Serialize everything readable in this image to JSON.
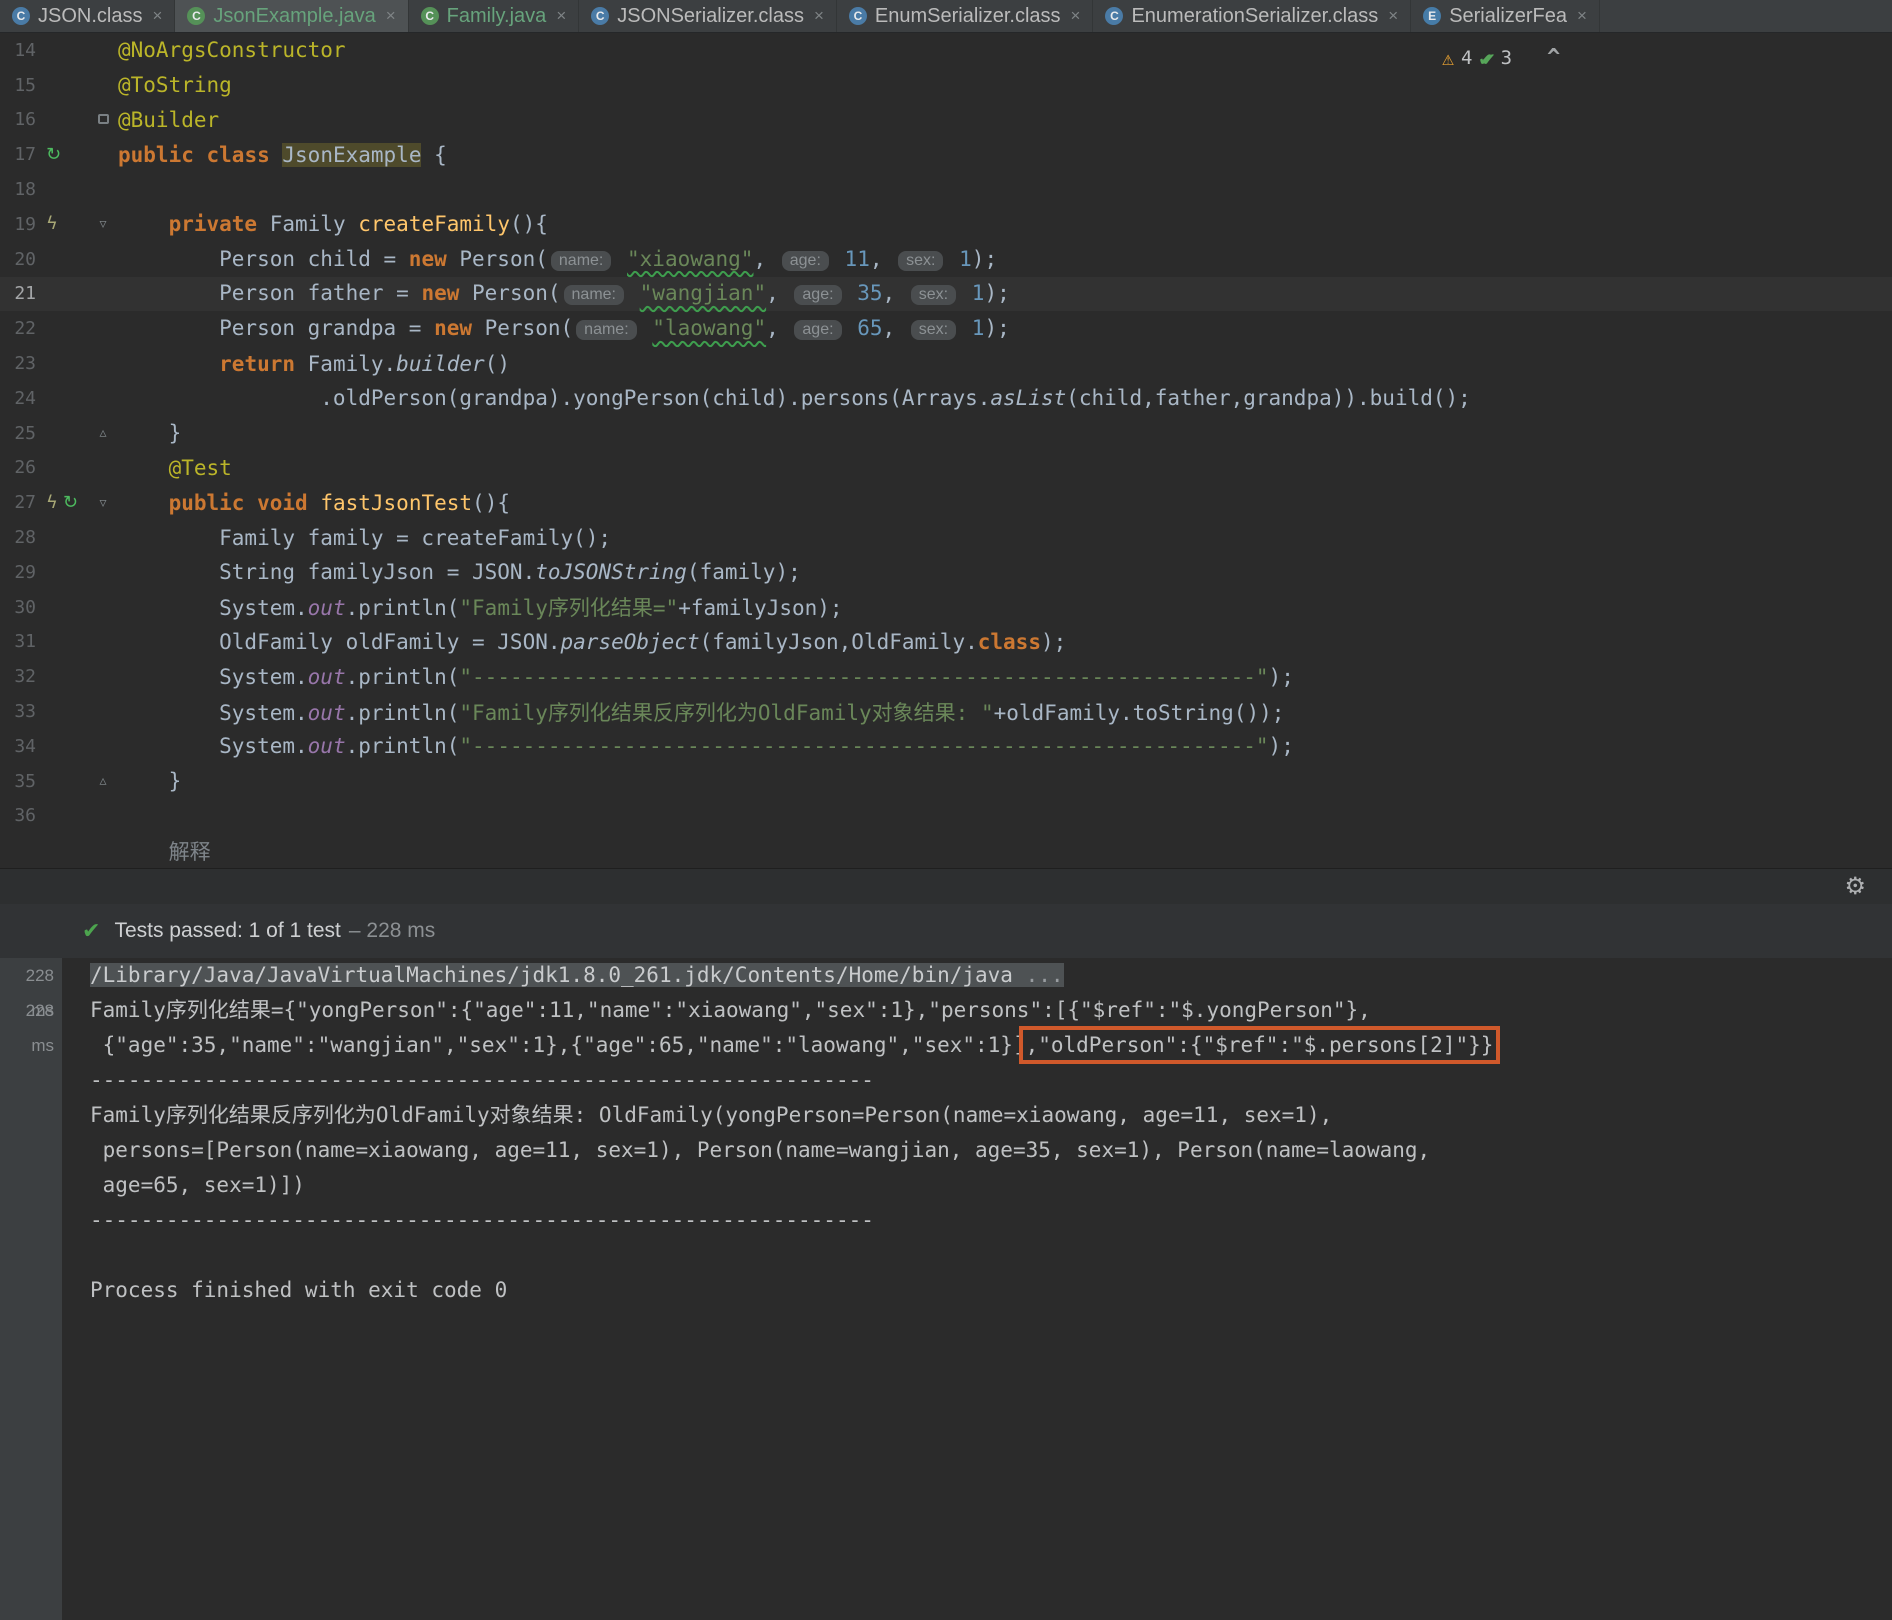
{
  "colors": {
    "accent_green": "#67a37c",
    "annotation_orange": "#d0592b",
    "warning_yellow": "#f0a732",
    "editor_background": "#2b2b2b"
  },
  "tab_bar": {
    "close_glyph": "×",
    "tabs": [
      {
        "label": "JSON.class",
        "icon_letter": "C",
        "icon_class": "fi-blue",
        "icon_name": "class-file-icon",
        "active": false,
        "green": false
      },
      {
        "label": "JsonExample.java",
        "icon_letter": "C",
        "icon_class": "fi-green",
        "icon_name": "test-class-file-icon",
        "active": true,
        "green": true
      },
      {
        "label": "Family.java",
        "icon_letter": "C",
        "icon_class": "fi-green",
        "icon_name": "test-class-file-icon",
        "active": false,
        "green": true
      },
      {
        "label": "JSONSerializer.class",
        "icon_letter": "C",
        "icon_class": "fi-blue",
        "icon_name": "class-file-icon",
        "active": false,
        "green": false
      },
      {
        "label": "EnumSerializer.class",
        "icon_letter": "C",
        "icon_class": "fi-blue",
        "icon_name": "class-file-icon",
        "active": false,
        "green": false
      },
      {
        "label": "EnumerationSerializer.class",
        "icon_letter": "C",
        "icon_class": "fi-blue",
        "icon_name": "class-file-icon",
        "active": false,
        "green": false
      },
      {
        "label": "SerializerFea",
        "icon_letter": "E",
        "icon_class": "fi-enum",
        "icon_name": "enum-file-icon",
        "active": false,
        "green": false
      }
    ]
  },
  "editor": {
    "inspections": {
      "warning_icon": "⚠",
      "warning_count": "4",
      "ok_icon": "✔✔",
      "ok_count": "3",
      "chevron": "^"
    },
    "lines": [
      {
        "num": "14",
        "tokens": [
          {
            "t": "@NoArgsConstructor",
            "s": "ann"
          }
        ]
      },
      {
        "num": "15",
        "tokens": [
          {
            "t": "@ToString",
            "s": "ann"
          }
        ]
      },
      {
        "num": "16",
        "fold": "sq",
        "tokens": [
          {
            "t": "@Builder",
            "s": "ann"
          }
        ]
      },
      {
        "num": "17",
        "gutter": [
          "rerun"
        ],
        "tokens": [
          {
            "t": "public",
            "s": "kw"
          },
          {
            "t": " ",
            "s": "p"
          },
          {
            "t": "class",
            "s": "kw"
          },
          {
            "t": " ",
            "s": "p"
          },
          {
            "t": "JsonExample",
            "s": "hl"
          },
          {
            "t": " {",
            "s": "p"
          }
        ]
      },
      {
        "num": "18",
        "tokens": []
      },
      {
        "num": "19",
        "gutter": [
          "bolt"
        ],
        "fold": "down",
        "tokens": [
          {
            "t": "    ",
            "s": "p"
          },
          {
            "t": "private",
            "s": "kw"
          },
          {
            "t": " Family ",
            "s": "p"
          },
          {
            "t": "createFamily",
            "s": "md"
          },
          {
            "t": "(){",
            "s": "p"
          }
        ]
      },
      {
        "num": "20",
        "tokens": [
          {
            "t": "        Person child = ",
            "s": "p"
          },
          {
            "t": "new",
            "s": "kw"
          },
          {
            "t": " Person(",
            "s": "p"
          },
          {
            "t": "name:",
            "s": "hint"
          },
          {
            "t": " ",
            "s": "p"
          },
          {
            "t": "\"xiaowang\"",
            "s": "sw"
          },
          {
            "t": ", ",
            "s": "p"
          },
          {
            "t": "age:",
            "s": "hint"
          },
          {
            "t": " ",
            "s": "p"
          },
          {
            "t": "11",
            "s": "num"
          },
          {
            "t": ", ",
            "s": "p"
          },
          {
            "t": "sex:",
            "s": "hint"
          },
          {
            "t": " ",
            "s": "p"
          },
          {
            "t": "1",
            "s": "num"
          },
          {
            "t": ");",
            "s": "p"
          }
        ]
      },
      {
        "num": "21",
        "current": true,
        "tokens": [
          {
            "t": "        Person father = ",
            "s": "p"
          },
          {
            "t": "new",
            "s": "kw"
          },
          {
            "t": " Person(",
            "s": "p"
          },
          {
            "t": "name:",
            "s": "hint"
          },
          {
            "t": " ",
            "s": "p"
          },
          {
            "t": "\"wangjian\"",
            "s": "sw"
          },
          {
            "t": ", ",
            "s": "p"
          },
          {
            "t": "age:",
            "s": "hint"
          },
          {
            "t": " ",
            "s": "p"
          },
          {
            "t": "35",
            "s": "num"
          },
          {
            "t": ", ",
            "s": "p"
          },
          {
            "t": "sex:",
            "s": "hint"
          },
          {
            "t": " ",
            "s": "p"
          },
          {
            "t": "1",
            "s": "num"
          },
          {
            "t": ");",
            "s": "p"
          }
        ]
      },
      {
        "num": "22",
        "tokens": [
          {
            "t": "        Person grandpa = ",
            "s": "p"
          },
          {
            "t": "new",
            "s": "kw"
          },
          {
            "t": " Person(",
            "s": "p"
          },
          {
            "t": "name:",
            "s": "hint"
          },
          {
            "t": " ",
            "s": "p"
          },
          {
            "t": "\"laowang\"",
            "s": "sw"
          },
          {
            "t": ", ",
            "s": "p"
          },
          {
            "t": "age:",
            "s": "hint"
          },
          {
            "t": " ",
            "s": "p"
          },
          {
            "t": "65",
            "s": "num"
          },
          {
            "t": ", ",
            "s": "p"
          },
          {
            "t": "sex:",
            "s": "hint"
          },
          {
            "t": " ",
            "s": "p"
          },
          {
            "t": "1",
            "s": "num"
          },
          {
            "t": ");",
            "s": "p"
          }
        ]
      },
      {
        "num": "23",
        "tokens": [
          {
            "t": "        ",
            "s": "p"
          },
          {
            "t": "return",
            "s": "kw"
          },
          {
            "t": " Family.",
            "s": "p"
          },
          {
            "t": "builder",
            "s": "sm"
          },
          {
            "t": "()",
            "s": "p"
          }
        ]
      },
      {
        "num": "24",
        "tokens": [
          {
            "t": "                .oldPerson(grandpa).yongPerson(child).persons(Arrays.",
            "s": "p"
          },
          {
            "t": "asList",
            "s": "sm"
          },
          {
            "t": "(child,father,grandpa)).build();",
            "s": "p"
          }
        ]
      },
      {
        "num": "25",
        "fold": "up",
        "tokens": [
          {
            "t": "    }",
            "s": "p"
          }
        ]
      },
      {
        "num": "26",
        "tokens": [
          {
            "t": "    ",
            "s": "p"
          },
          {
            "t": "@Test",
            "s": "ann"
          }
        ]
      },
      {
        "num": "27",
        "gutter": [
          "bolt",
          "rerun"
        ],
        "fold": "down",
        "tokens": [
          {
            "t": "    ",
            "s": "p"
          },
          {
            "t": "public",
            "s": "kw"
          },
          {
            "t": " ",
            "s": "p"
          },
          {
            "t": "void",
            "s": "kw"
          },
          {
            "t": " ",
            "s": "p"
          },
          {
            "t": "fastJsonTest",
            "s": "md"
          },
          {
            "t": "(){",
            "s": "p"
          }
        ]
      },
      {
        "num": "28",
        "tokens": [
          {
            "t": "        Family family = createFamily();",
            "s": "p"
          }
        ]
      },
      {
        "num": "29",
        "tokens": [
          {
            "t": "        String familyJson = JSON.",
            "s": "p"
          },
          {
            "t": "toJSONString",
            "s": "sm"
          },
          {
            "t": "(family);",
            "s": "p"
          }
        ]
      },
      {
        "num": "30",
        "tokens": [
          {
            "t": "        System.",
            "s": "p"
          },
          {
            "t": "out",
            "s": "fld"
          },
          {
            "t": ".println(",
            "s": "p"
          },
          {
            "t": "\"Family序列化结果=\"",
            "s": "str"
          },
          {
            "t": "+familyJson);",
            "s": "p"
          }
        ]
      },
      {
        "num": "31",
        "tokens": [
          {
            "t": "        OldFamily oldFamily = JSON.",
            "s": "p"
          },
          {
            "t": "parseObject",
            "s": "sm"
          },
          {
            "t": "(familyJson,OldFamily.",
            "s": "p"
          },
          {
            "t": "class",
            "s": "kw"
          },
          {
            "t": ");",
            "s": "p"
          }
        ]
      },
      {
        "num": "32",
        "tokens": [
          {
            "t": "        System.",
            "s": "p"
          },
          {
            "t": "out",
            "s": "fld"
          },
          {
            "t": ".println(",
            "s": "p"
          },
          {
            "t": "\"--------------------------------------------------------------\"",
            "s": "str"
          },
          {
            "t": ");",
            "s": "p"
          }
        ]
      },
      {
        "num": "33",
        "tokens": [
          {
            "t": "        System.",
            "s": "p"
          },
          {
            "t": "out",
            "s": "fld"
          },
          {
            "t": ".println(",
            "s": "p"
          },
          {
            "t": "\"Family序列化结果反序列化为OldFamily对象结果: \"",
            "s": "str"
          },
          {
            "t": "+oldFamily.toString());",
            "s": "p"
          }
        ]
      },
      {
        "num": "34",
        "tokens": [
          {
            "t": "        System.",
            "s": "p"
          },
          {
            "t": "out",
            "s": "fld"
          },
          {
            "t": ".println(",
            "s": "p"
          },
          {
            "t": "\"--------------------------------------------------------------\"",
            "s": "str"
          },
          {
            "t": ");",
            "s": "p"
          }
        ]
      },
      {
        "num": "35",
        "fold": "up",
        "tokens": [
          {
            "t": "    }",
            "s": "p"
          }
        ]
      },
      {
        "num": "36",
        "tokens": []
      },
      {
        "num": "",
        "tokens": [
          {
            "t": "    解释",
            "s": "inlay"
          }
        ]
      }
    ]
  },
  "run_panel": {
    "status": {
      "icon": "✔",
      "text": "Tests passed: 1 of 1 test",
      "duration": "– 228 ms"
    },
    "gear_icon": "⚙"
  },
  "console": {
    "gutter_times": [
      "228 ms",
      "228 ms"
    ],
    "lines": [
      [
        {
          "t": "/Library/Java/JavaVirtualMachines/jdk1.8.0_261.jdk/Contents/Home/bin/java",
          "s": "sel"
        },
        {
          "t": " ...",
          "s": "seldim"
        }
      ],
      [
        {
          "t": "Family序列化结果={\"yongPerson\":{\"age\":11,\"name\":\"xiaowang\",\"sex\":1},\"persons\":[{\"$ref\":\"$.yongPerson\"},",
          "s": "p"
        }
      ],
      [
        {
          "t": " {\"age\":35,\"name\":\"wangjian\",\"sex\":1},{\"age\":65,\"name\":\"laowang\",\"sex\":1}]",
          "s": "p"
        },
        {
          "t": ",\"oldPerson\":{\"$ref\":\"$.persons[2]\"}}",
          "s": "boxed"
        }
      ],
      [
        {
          "t": "--------------------------------------------------------------",
          "s": "p"
        }
      ],
      [
        {
          "t": "Family序列化结果反序列化为OldFamily对象结果: OldFamily(yongPerson=Person(name=xiaowang, age=11, sex=1),",
          "s": "p"
        }
      ],
      [
        {
          "t": " persons=[Person(name=xiaowang, age=11, sex=1), Person(name=wangjian, age=35, sex=1), Person(name=laowang,",
          "s": "p"
        }
      ],
      [
        {
          "t": " age=65, sex=1)])",
          "s": "p"
        }
      ],
      [
        {
          "t": "--------------------------------------------------------------",
          "s": "p"
        }
      ],
      [],
      [
        {
          "t": "Process finished with exit code 0",
          "s": "p"
        }
      ]
    ]
  }
}
